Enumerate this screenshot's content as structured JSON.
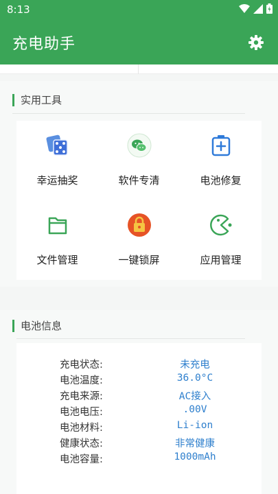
{
  "status_bar": {
    "time": "8:13"
  },
  "app_bar": {
    "title": "充电助手",
    "settings_icon": "gear-icon"
  },
  "colors": {
    "primary": "#3aa557",
    "value_text": "#2e7fcd"
  },
  "tools_section": {
    "title": "实用工具",
    "items": [
      {
        "label": "幸运抽奖",
        "icon": "dice-icon"
      },
      {
        "label": "软件专清",
        "icon": "wechat-icon"
      },
      {
        "label": "电池修复",
        "icon": "battery-plus-icon"
      },
      {
        "label": "文件管理",
        "icon": "folder-icon"
      },
      {
        "label": "一键锁屏",
        "icon": "lock-icon"
      },
      {
        "label": "应用管理",
        "icon": "pacman-icon"
      }
    ]
  },
  "battery_section": {
    "title": "电池信息",
    "rows": [
      {
        "key": "充电状态:",
        "value": "未充电"
      },
      {
        "key": "电池温度:",
        "value": "36.0°C"
      },
      {
        "key": "充电来源:",
        "value": "AC接入"
      },
      {
        "key": "电池电压:",
        "value": ".00V"
      },
      {
        "key": "电池材料:",
        "value": "Li-ion"
      },
      {
        "key": "健康状态:",
        "value": "非常健康"
      },
      {
        "key": "电池容量:",
        "value": "1000mAh"
      }
    ]
  }
}
